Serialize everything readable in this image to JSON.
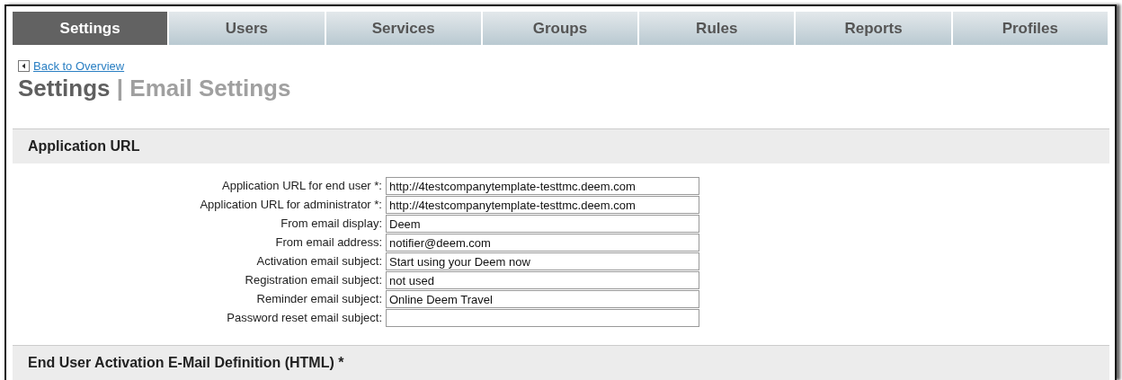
{
  "tabs": [
    {
      "label": "Settings",
      "selected": true
    },
    {
      "label": "Users",
      "selected": false
    },
    {
      "label": "Services",
      "selected": false
    },
    {
      "label": "Groups",
      "selected": false
    },
    {
      "label": "Rules",
      "selected": false
    },
    {
      "label": "Reports",
      "selected": false
    },
    {
      "label": "Profiles",
      "selected": false
    }
  ],
  "back_link": "Back to Overview",
  "heading": {
    "section": "Settings",
    "separator": "|",
    "page": "Email Settings"
  },
  "sections": [
    {
      "title": "Application URL",
      "fields": [
        {
          "label": "Application URL for end user *:",
          "value": "http://4testcompanytemplate-testtmc.deem.com"
        },
        {
          "label": "Application URL for administrator *:",
          "value": "http://4testcompanytemplate-testtmc.deem.com"
        },
        {
          "label": "From email display:",
          "value": "Deem"
        },
        {
          "label": "From email address:",
          "value": "notifier@deem.com"
        },
        {
          "label": "Activation email subject:",
          "value": "Start using your Deem now"
        },
        {
          "label": "Registration email subject:",
          "value": "not used"
        },
        {
          "label": "Reminder email subject:",
          "value": "Online Deem Travel"
        },
        {
          "label": "Password reset email subject:"
        }
      ]
    },
    {
      "title": "End User Activation E-Mail Definition (HTML) *"
    }
  ]
}
